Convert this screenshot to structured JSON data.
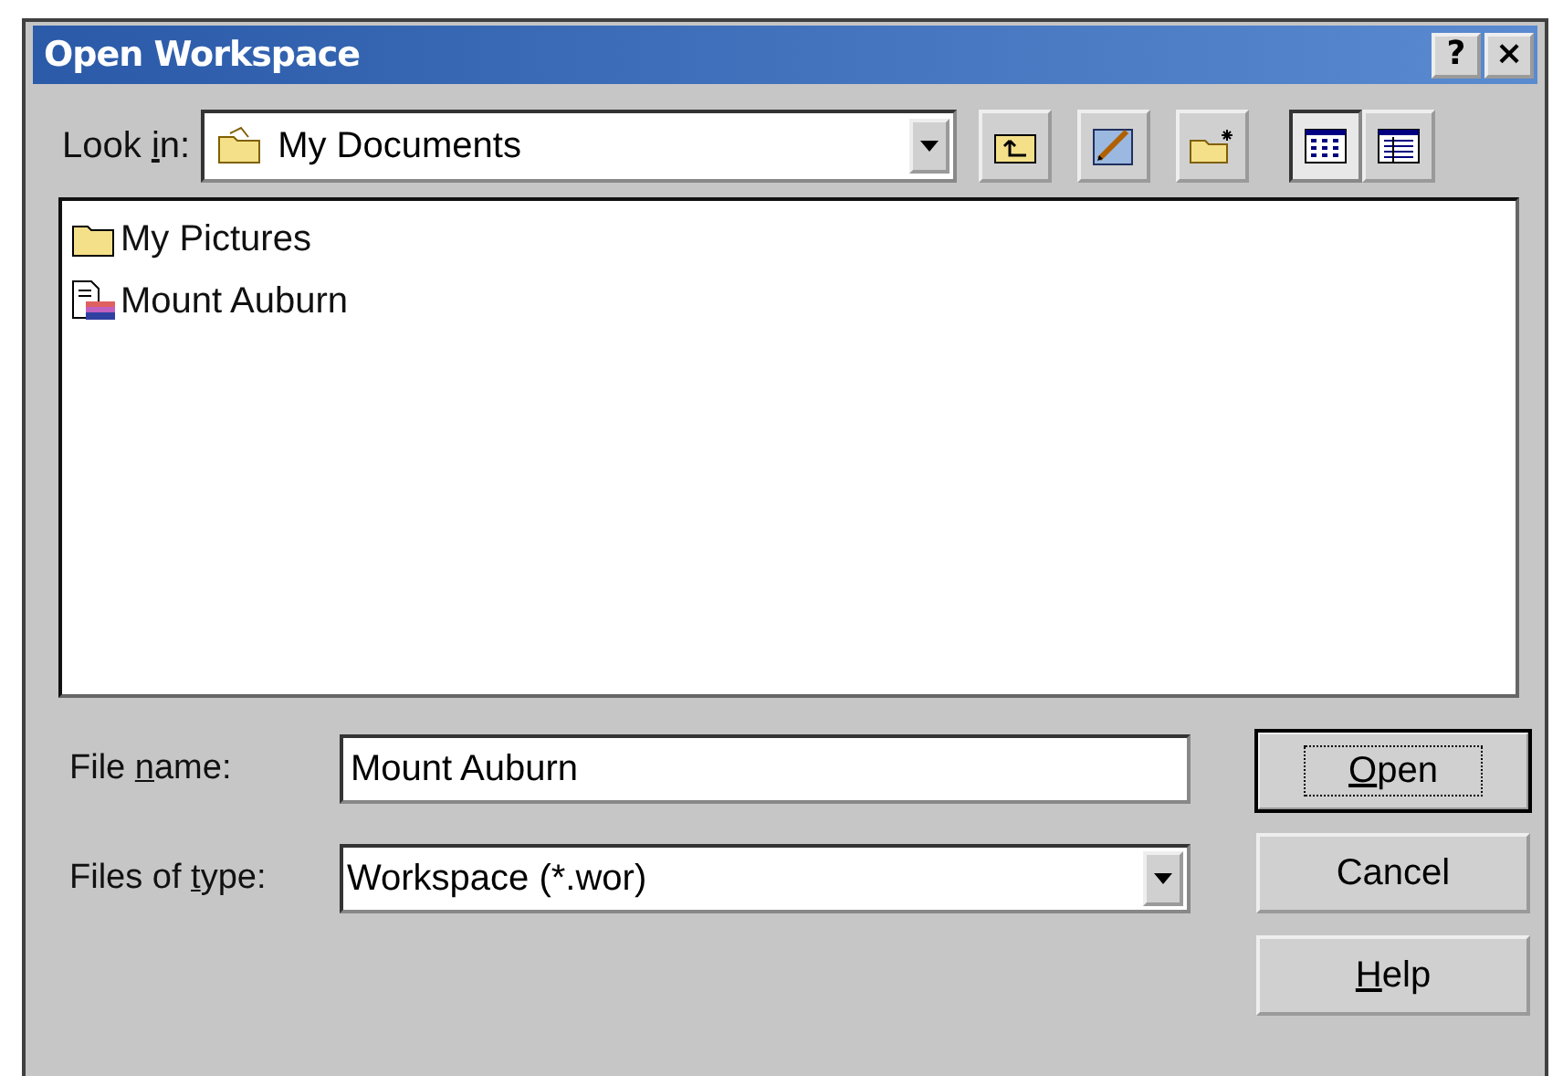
{
  "window": {
    "title": "Open Workspace",
    "title_buttons": [
      "?",
      "×"
    ]
  },
  "look_in": {
    "label": {
      "before": "Look ",
      "accel": "i",
      "after": "n:"
    },
    "value": "My Documents"
  },
  "toolbar": [
    {
      "kind": "up",
      "selected": false
    },
    {
      "kind": "edit",
      "selected": false
    },
    {
      "kind": "newfolder",
      "selected": false
    },
    {
      "kind": "list",
      "selected": true
    },
    {
      "kind": "details",
      "selected": false
    }
  ],
  "files": [
    {
      "name": "My Pictures",
      "kind": "folder"
    },
    {
      "name": "Mount Auburn",
      "kind": "workspace"
    }
  ],
  "file_name": {
    "label": {
      "before": "File ",
      "accel": "n",
      "after": "ame:"
    },
    "value": "Mount Auburn"
  },
  "file_type": {
    "label": {
      "before": "Files of ",
      "accel": "t",
      "after": "ype:"
    },
    "value": "Workspace (*.wor)"
  },
  "buttons": [
    {
      "accel": "O",
      "after": "pen",
      "default": true
    },
    {
      "before": "Cancel",
      "default": false
    },
    {
      "accel": "H",
      "after": "elp",
      "default": false
    }
  ]
}
